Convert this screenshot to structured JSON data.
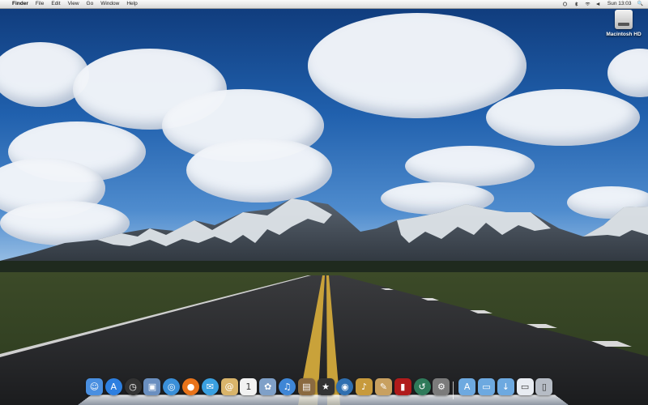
{
  "menubar": {
    "apple_glyph": "",
    "app_name": "Finder",
    "menus": [
      "File",
      "Edit",
      "View",
      "Go",
      "Window",
      "Help"
    ],
    "clock": "Sun 13:03",
    "search_glyph": "🔍"
  },
  "desktop": {
    "icons": [
      {
        "label": "Macintosh HD",
        "icon": "hard-drive-icon"
      }
    ]
  },
  "dock": {
    "apps": [
      {
        "name": "finder-icon",
        "color": "#4a8fe0",
        "glyph": "☺"
      },
      {
        "name": "app-store-icon",
        "color": "#2d7fe0",
        "glyph": "A"
      },
      {
        "name": "dashboard-icon",
        "color": "#333333",
        "glyph": "◷"
      },
      {
        "name": "preview-icon",
        "color": "#6a8fc0",
        "glyph": "▣"
      },
      {
        "name": "safari-icon",
        "color": "#3a8fd8",
        "glyph": "◎"
      },
      {
        "name": "firefox-icon",
        "color": "#e8731a",
        "glyph": "●"
      },
      {
        "name": "ichat-icon",
        "color": "#3aa0e0",
        "glyph": "✉"
      },
      {
        "name": "address-book-icon",
        "color": "#d9b46a",
        "glyph": "@"
      },
      {
        "name": "ical-icon",
        "color": "#f2f2f2",
        "glyph": "1"
      },
      {
        "name": "iphoto-icon",
        "color": "#7fa0c8",
        "glyph": "✿"
      },
      {
        "name": "itunes-icon",
        "color": "#3f86d6",
        "glyph": "♫"
      },
      {
        "name": "image-icon",
        "color": "#8a6a40",
        "glyph": "▤"
      },
      {
        "name": "imovie-icon",
        "color": "#333333",
        "glyph": "★"
      },
      {
        "name": "dvd-player-icon",
        "color": "#2f6fb0",
        "glyph": "◉"
      },
      {
        "name": "garageband-icon",
        "color": "#c79a3c",
        "glyph": "♪"
      },
      {
        "name": "utility-icon",
        "color": "#c8a060",
        "glyph": "✎"
      },
      {
        "name": "photo-booth-icon",
        "color": "#b01b1b",
        "glyph": "▮"
      },
      {
        "name": "time-machine-icon",
        "color": "#2f7a5a",
        "glyph": "↺"
      },
      {
        "name": "system-preferences-icon",
        "color": "#7b7b7b",
        "glyph": "⚙"
      },
      {
        "name": "applications-folder-icon",
        "color": "#6da9e0",
        "glyph": "A"
      },
      {
        "name": "documents-folder-icon",
        "color": "#6da9e0",
        "glyph": "▭"
      },
      {
        "name": "downloads-folder-icon",
        "color": "#6da9e0",
        "glyph": "↓"
      },
      {
        "name": "screen-sharing-icon",
        "color": "#e8ecf2",
        "glyph": "▭"
      },
      {
        "name": "trash-icon",
        "color": "#b6bcc5",
        "glyph": "▯"
      }
    ]
  }
}
